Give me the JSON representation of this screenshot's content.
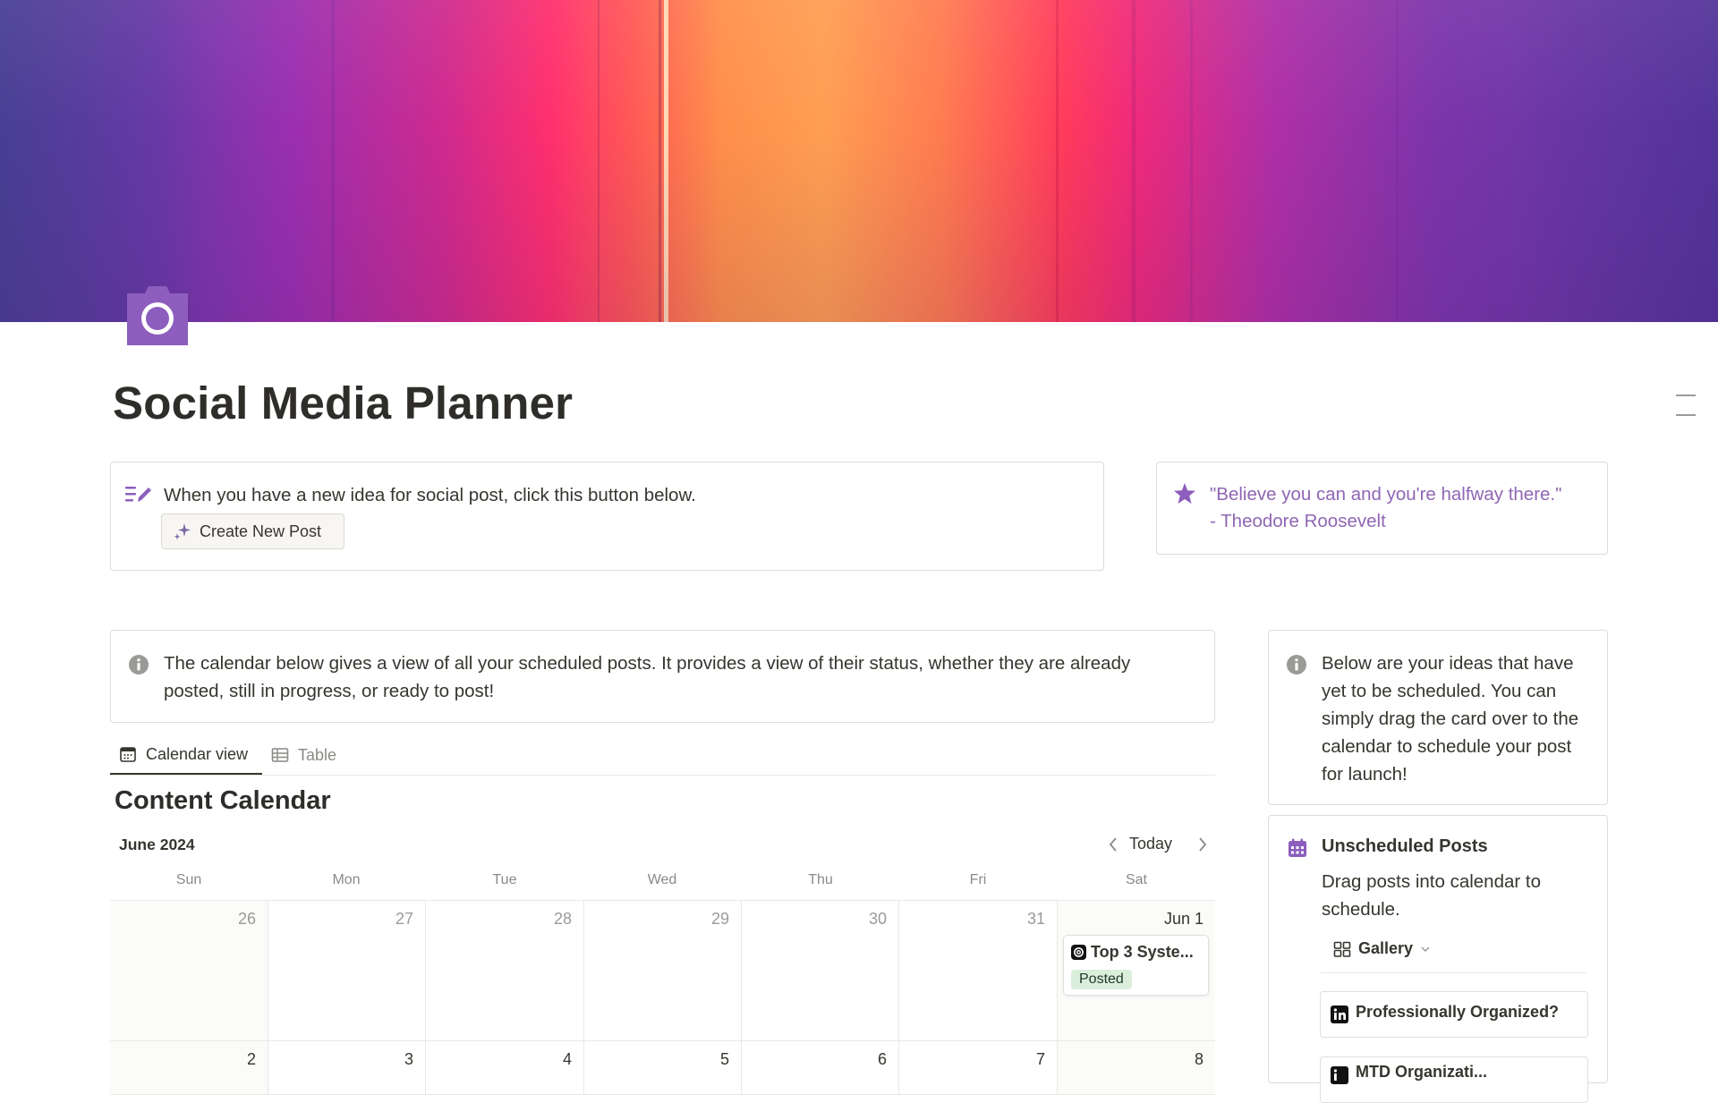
{
  "page": {
    "title": "Social Media Planner",
    "icon": "camera-icon",
    "cover": "abstract-gradient-cover"
  },
  "colors": {
    "accent_purple": "#8f66b4",
    "posted_badge_bg": "#dbeddb",
    "posted_badge_text": "#1c3829",
    "border": "#dedcd8"
  },
  "idea_callout": {
    "icon": "pencil-lines-icon",
    "text": "When you have a new idea for social post, click this button below.",
    "button": {
      "icon": "sparkle-icon",
      "label": "Create New Post"
    }
  },
  "quote_callout": {
    "icon": "star-icon",
    "text": "\"Believe you can and you're halfway there.\" - Theodore Roosevelt"
  },
  "calendar_callout": {
    "icon": "info-icon",
    "text": "The calendar below gives a view of all your scheduled posts. It provides a view of their status, whether they are already posted, still in progress, or ready to post!"
  },
  "unscheduled_callout": {
    "icon": "info-icon",
    "text": "Below are your ideas that have yet to be scheduled. You can simply drag the card over to the calendar to schedule your post for launch!"
  },
  "views": {
    "tabs": [
      {
        "label": "Calendar view",
        "icon": "calendar-icon",
        "active": true
      },
      {
        "label": "Table",
        "icon": "table-icon",
        "active": false
      }
    ]
  },
  "calendar": {
    "title": "Content Calendar",
    "month": "June 2024",
    "today_label": "Today",
    "weekdays": [
      "Sun",
      "Mon",
      "Tue",
      "Wed",
      "Thu",
      "Fri",
      "Sat"
    ],
    "rows": [
      [
        "26",
        "27",
        "28",
        "29",
        "30",
        "31",
        "Jun 1"
      ],
      [
        "2",
        "3",
        "4",
        "5",
        "6",
        "7",
        "8"
      ]
    ],
    "events": [
      {
        "date": "Jun 1",
        "icon": "threads-icon",
        "title": "Top 3 Syste...",
        "status": "Posted"
      }
    ]
  },
  "unscheduled": {
    "icon": "calendar-icon",
    "title": "Unscheduled Posts",
    "subtitle": "Drag posts into calendar to schedule.",
    "view": {
      "icon": "gallery-icon",
      "label": "Gallery"
    },
    "cards": [
      {
        "icon": "linkedin-icon",
        "title": "Professionally Organized?"
      },
      {
        "icon": "linkedin-icon",
        "title": "MTD Organizati..."
      }
    ]
  }
}
